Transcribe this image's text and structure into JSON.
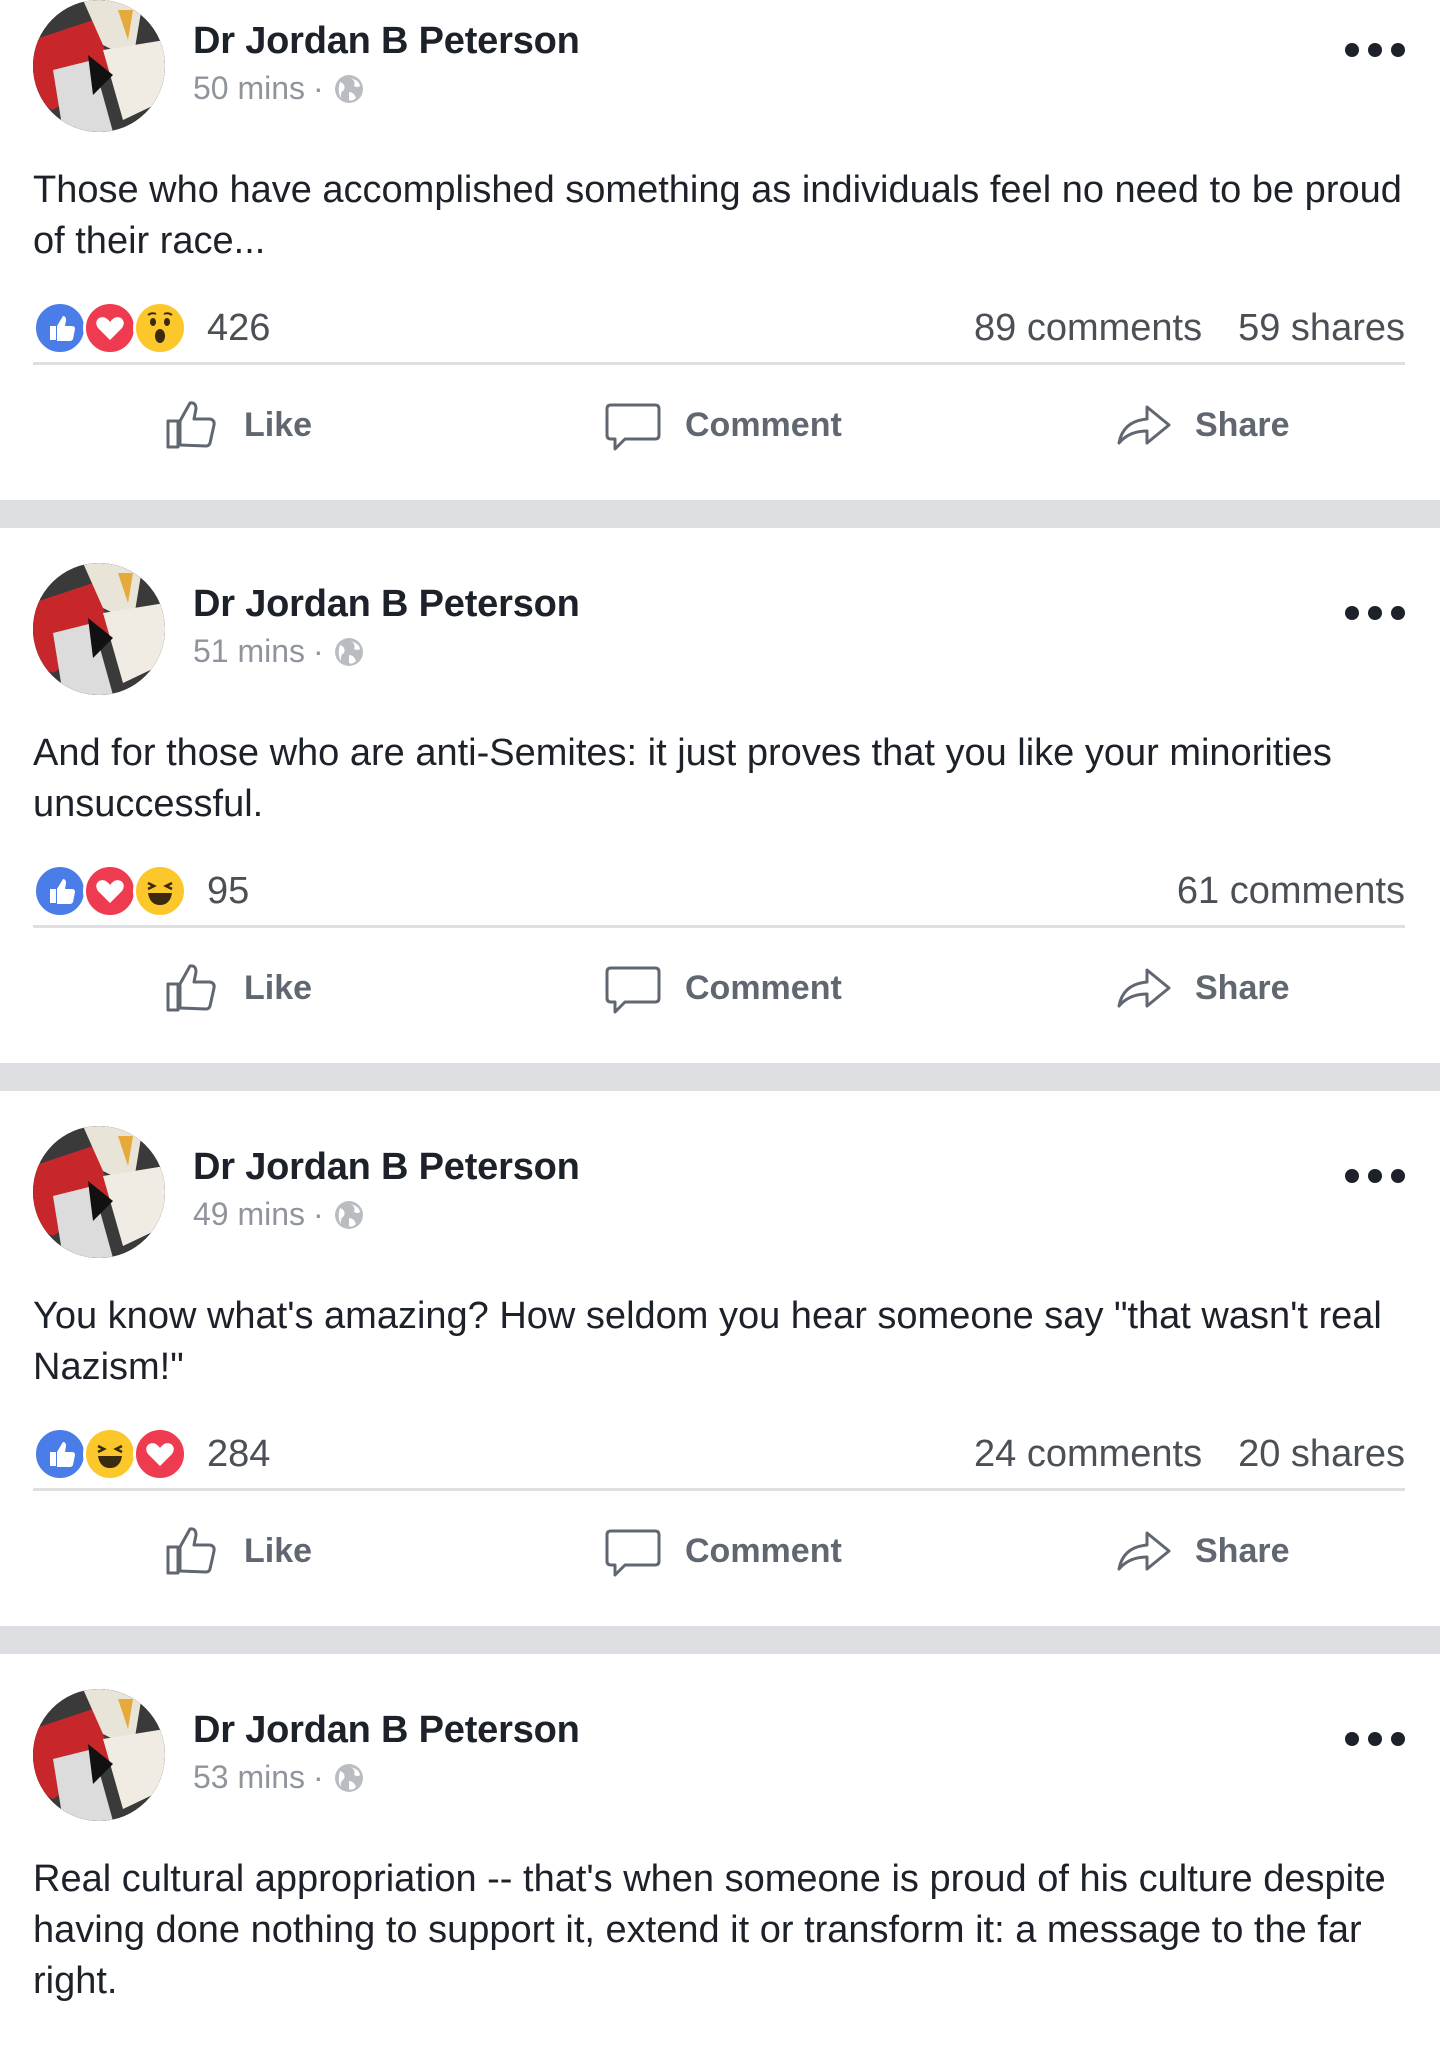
{
  "posts": [
    {
      "author": "Dr Jordan B Peterson",
      "time": "50 mins",
      "dot": "·",
      "text": "Those who have accomplished something as individuals feel no need to be proud of their race...",
      "reactions": [
        "like",
        "love",
        "wow"
      ],
      "reaction_count": "426",
      "comments": "89 comments",
      "shares": "59 shares",
      "actions": {
        "like": "Like",
        "comment": "Comment",
        "share": "Share"
      }
    },
    {
      "author": "Dr Jordan B Peterson",
      "time": "51 mins",
      "dot": "·",
      "text": "And for those who are anti-Semites: it just proves that you like your minorities unsuccessful.",
      "reactions": [
        "like",
        "love",
        "haha"
      ],
      "reaction_count": "95",
      "comments": "61 comments",
      "shares": "",
      "actions": {
        "like": "Like",
        "comment": "Comment",
        "share": "Share"
      }
    },
    {
      "author": "Dr Jordan B Peterson",
      "time": "49 mins",
      "dot": "·",
      "text": "You know what's amazing? How seldom you hear someone say \"that wasn't real Nazism!\"",
      "reactions": [
        "like",
        "haha",
        "love"
      ],
      "reaction_count": "284",
      "comments": "24 comments",
      "shares": "20 shares",
      "actions": {
        "like": "Like",
        "comment": "Comment",
        "share": "Share"
      }
    },
    {
      "author": "Dr Jordan B Peterson",
      "time": "53 mins",
      "dot": "·",
      "text": "Real cultural appropriation -- that's when someone is proud of his culture despite having done nothing to support it, extend it or transform it: a message to the far right."
    }
  ],
  "colors": {
    "like": "#4a7de7",
    "love": "#ee3b4f",
    "wow_haha": "#fbc72b",
    "separator": "#dddfe2",
    "meta": "#90949c"
  }
}
